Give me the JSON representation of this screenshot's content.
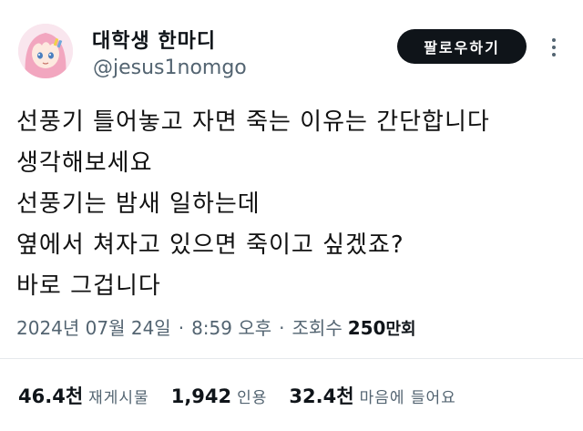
{
  "author": {
    "display_name": "대학생 한마디",
    "handle": "@jesus1nomgo"
  },
  "follow_label": "팔로우하기",
  "tweet_lines": [
    "선풍기 틀어놓고 자면 죽는 이유는 간단합니다",
    "생각해보세요",
    "선풍기는 밤새 일하는데",
    "옆에서 쳐자고 있으면 죽이고 싶겠죠?",
    "바로 그겁니다"
  ],
  "meta": {
    "date": "2024년 07월 24일",
    "time": "8:59 오후",
    "views_prefix": "조회수",
    "views_count": "250",
    "views_unit": "만회"
  },
  "stats": {
    "retweets_count": "46.4천",
    "retweets_label": "재게시물",
    "quotes_count": "1,942",
    "quotes_label": "인용",
    "likes_count": "32.4천",
    "likes_label": "마음에 들어요"
  },
  "colors": {
    "text": "#0f1419",
    "secondary": "#536471",
    "button_bg": "#0f1419",
    "avatar_hair": "#f2a6bf"
  }
}
